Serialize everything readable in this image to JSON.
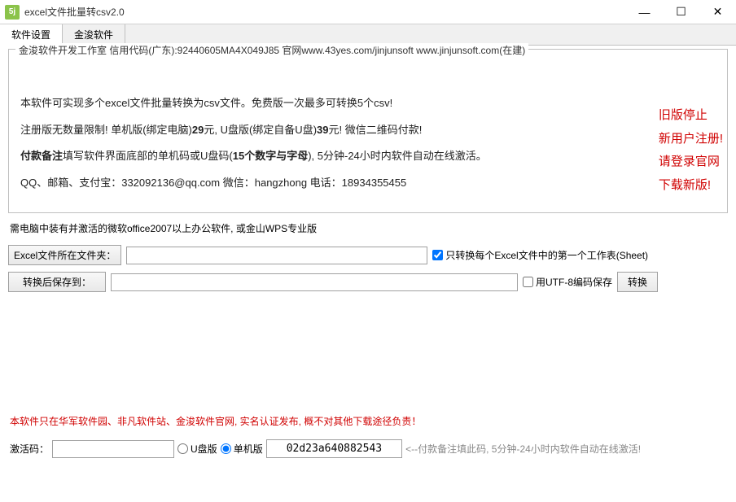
{
  "window": {
    "icon_text": "5j",
    "title": "excel文件批量转csv2.0",
    "min": "—",
    "max": "☐",
    "close": "✕"
  },
  "tabs": {
    "t1": "软件设置",
    "t2": "金浚软件"
  },
  "info": {
    "legend": "金浚软件开发工作室 信用代码(广东):92440605MA4X049J85 官网www.43yes.com/jinjunsoft  www.jinjunsoft.com(在建)",
    "line1_a": "本软件可实现多个excel文件批量转换为csv文件。免费版一次最多可转换5个csv!",
    "line2_a": "注册版无数量限制! 单机版(绑定电脑)",
    "line2_b": "29",
    "line2_c": "元, U盘版(绑定自备U盘)",
    "line2_d": "39",
    "line2_e": "元! 微信二维码付款!",
    "line3_a": "付款备注",
    "line3_b": "填写软件界面底部的单机码或U盘码(",
    "line3_c": "15个数字与字母",
    "line3_d": "), 5分钟-24小时内软件自动在线激活。",
    "line4": "QQ、邮箱、支付宝：332092136@qq.com  微信：hangzhong   电话：18934355455"
  },
  "side_note": {
    "l1": "旧版停止",
    "l2": "新用户注册!",
    "l3": "请登录官网",
    "l4": "下载新版!"
  },
  "req": "需电脑中装有并激活的微软office2007以上办公软件, 或金山WPS专业版",
  "row1": {
    "btn": "Excel文件所在文件夹：",
    "value": "",
    "chk_label": "只转换每个Excel文件中的第一个工作表(Sheet)"
  },
  "row2": {
    "btn": "转换后保存到：",
    "value": "",
    "chk_label": "用UTF-8编码保存",
    "convert": "转换"
  },
  "warn": "本软件只在华军软件园、非凡软件站、金浚软件官网, 实名认证发布, 概不对其他下载途径负责！",
  "bottom": {
    "label": "激活码：",
    "value": "",
    "radio_u": "U盘版",
    "radio_single": "单机版",
    "code": "02d23a640882543",
    "hint": "<--付款备注填此码, 5分钟-24小时内软件自动在线激活!"
  }
}
